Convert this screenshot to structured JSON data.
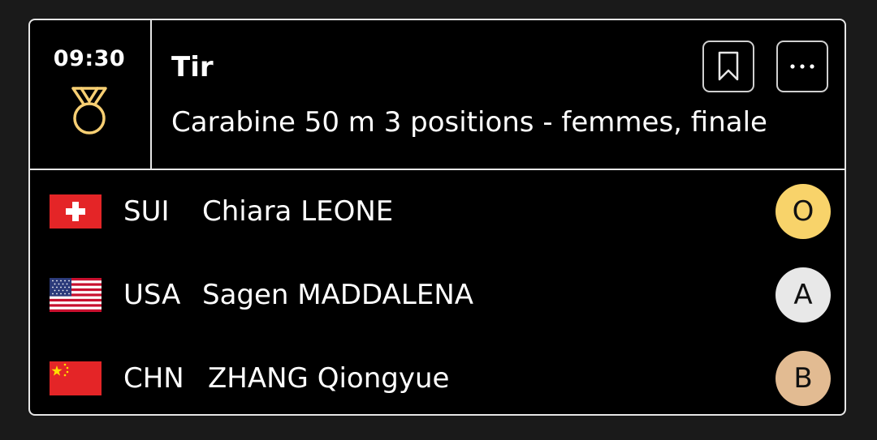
{
  "header": {
    "time": "09:30",
    "sport": "Tir",
    "event": "Carabine 50 m 3 positions - femmes, finale",
    "medal_icon": "medal-icon",
    "bookmark_icon": "bookmark-icon",
    "more_icon": "more-horizontal-icon",
    "more_label": "···"
  },
  "results": [
    {
      "flag": "switzerland-flag",
      "code": "SUI",
      "name": "Chiara LEONE",
      "medal": "O",
      "medal_color": "#f8d36a"
    },
    {
      "flag": "usa-flag",
      "code": "USA",
      "name": "Sagen MADDALENA",
      "medal": "A",
      "medal_color": "#e8e8e8"
    },
    {
      "flag": "china-flag",
      "code": "CHN",
      "name": "ZHANG Qiongyue",
      "medal": "B",
      "medal_color": "#e2bb92"
    }
  ],
  "colors": {
    "background": "#1a1a1a",
    "card": "#000000",
    "border": "#e6e6e6",
    "gold_icon": "#f7cf73",
    "flag_red": "#e42527"
  }
}
